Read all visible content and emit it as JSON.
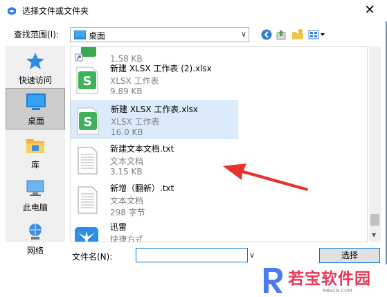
{
  "window": {
    "title": "选择文件或文件夹",
    "close_glyph": "✕"
  },
  "lookin": {
    "label": "查找范围(I):",
    "value": "桌面",
    "icon": "desktop-folder-icon"
  },
  "toolbar": {
    "icons": [
      "back-icon",
      "up-folder-icon",
      "new-folder-icon",
      "view-menu-icon"
    ]
  },
  "places": [
    {
      "label": "快速访问",
      "icon": "star-icon"
    },
    {
      "label": "桌面",
      "icon": "desktop-icon",
      "selected": true
    },
    {
      "label": "库",
      "icon": "library-icon"
    },
    {
      "label": "此电脑",
      "icon": "computer-icon"
    },
    {
      "label": "网络",
      "icon": "network-icon"
    }
  ],
  "files": [
    {
      "name": "",
      "type": "",
      "size": "1.58 KB",
      "icon": "shortcut-icon"
    },
    {
      "name": "新建 XLSX 工作表 (2).xlsx",
      "type": "XLSX 工作表",
      "size": "9.89 KB",
      "icon": "xlsx-icon"
    },
    {
      "name": "新建 XLSX 工作表.xlsx",
      "type": "XLSX 工作表",
      "size": "16.0 KB",
      "icon": "xlsx-icon",
      "selected": true
    },
    {
      "name": "新建文本文档.txt",
      "type": "文本文档",
      "size": "3.15 KB",
      "icon": "text-file-icon"
    },
    {
      "name": "新增（翻新）.txt",
      "type": "文本文档",
      "size": "298 字节",
      "icon": "text-file-icon"
    },
    {
      "name": "迅雷",
      "type": "快捷方式",
      "size": "",
      "icon": "xunlei-icon"
    }
  ],
  "filename": {
    "label": "文件名(N):",
    "value": "",
    "dropdown_glyph": "∨"
  },
  "buttons": {
    "select": "选择"
  },
  "watermark": {
    "text": "若宝软件园",
    "sub": "RBSCN.COM"
  },
  "colors": {
    "accent": "#0078d7",
    "selected_bg": "#dcebfc",
    "annotation_arrow": "#e8322e",
    "watermark": "#e8385b"
  }
}
